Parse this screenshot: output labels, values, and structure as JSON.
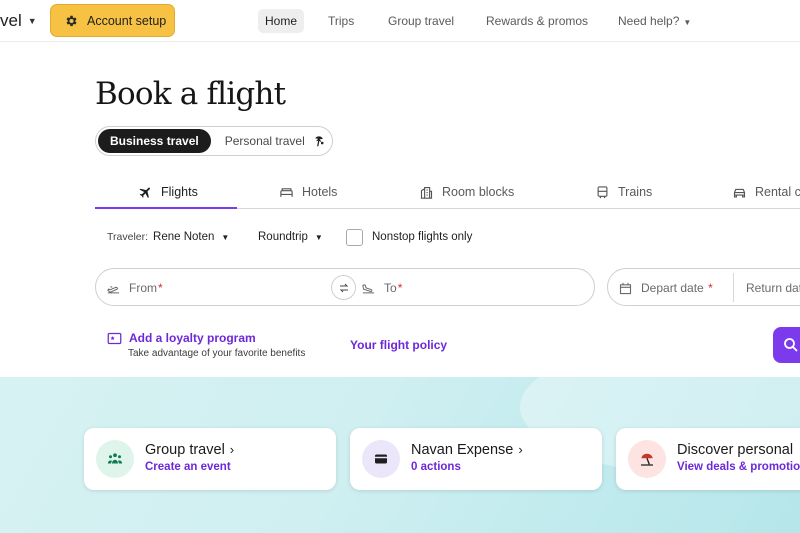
{
  "header": {
    "brand": "vel",
    "account_setup": "Account setup",
    "nav": [
      "Home",
      "Trips",
      "Group travel",
      "Rewards & promos",
      "Need help?"
    ]
  },
  "page": {
    "title": "Book a flight",
    "segment": {
      "business": "Business travel",
      "personal": "Personal travel"
    }
  },
  "tabs": [
    "Flights",
    "Hotels",
    "Room blocks",
    "Trains",
    "Rental ca"
  ],
  "options": {
    "traveler_label": "Traveler:",
    "traveler_value": "Rene Noten",
    "trip_type": "Roundtrip",
    "nonstop_label": "Nonstop flights only"
  },
  "search": {
    "from_placeholder": "From",
    "to_placeholder": "To",
    "depart_placeholder": "Depart date",
    "return_placeholder": "Return dat",
    "required_marker": "*"
  },
  "loyalty": {
    "link": "Add a loyalty program",
    "sub": "Take advantage of your favorite benefits"
  },
  "policy": "Your flight policy",
  "cards": [
    {
      "title": "Group travel",
      "sub": "Create an event",
      "icon": "group-icon"
    },
    {
      "title": "Navan Expense",
      "sub": "0 actions",
      "icon": "card-icon"
    },
    {
      "title": "Discover personal",
      "sub": "View deals & promotio",
      "icon": "beach-icon"
    }
  ],
  "colors": {
    "accent": "#7c3aed",
    "accent_text": "#6d28d9",
    "account_button": "#f7c244",
    "band": "#cfeff1"
  }
}
